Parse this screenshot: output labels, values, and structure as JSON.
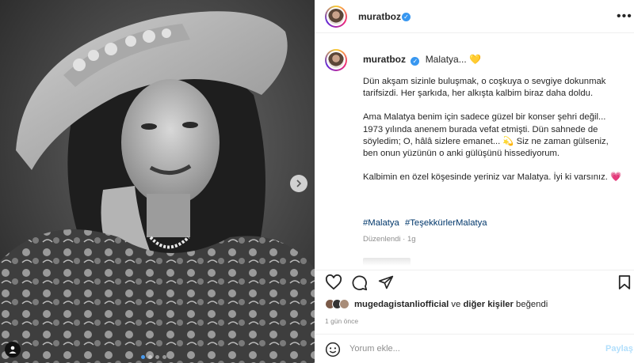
{
  "post": {
    "username": "muratboz",
    "caption_username": "muratboz",
    "location": "Malatya...",
    "location_emoji": "💛",
    "caption_paragraphs": [
      "Dün akşam sizinle buluşmak, o coşkuya o sevgiye dokunmak tarifsizdi. Her şarkıda, her alkışta kalbim biraz daha doldu.",
      "Ama Malatya benim için sadece güzel bir konser şehri değil... 1973 yılında anenem burada vefat etmişti. Dün sahnede de söyledim; O, hâlâ sizlere emanet... 💫 Siz ne zaman gülseniz, ben onun yüzünün o anki gülüşünü hissediyorum.",
      "Kalbimin en özel köşesinde yeriniz var Malatya. İyi ki varsınız. 💗"
    ],
    "hashtags": [
      "#Malatya",
      "#TeşekkürlerMalatya"
    ],
    "edited_label": "Düzenlendi · 1g",
    "liked_by_user": "mugedagistanliofficial",
    "liked_by_connector": "ve",
    "liked_by_others": "diğer kişiler",
    "liked_by_suffix": "beğendi",
    "time_ago": "1 gün önce",
    "comment_placeholder": "Yorum ekle...",
    "share_label": "Paylaş",
    "more_label": "•••"
  },
  "icons": {
    "verified": "verified-badge-icon",
    "heart": "heart-icon",
    "comment": "comment-icon",
    "share": "send-icon",
    "save": "bookmark-icon",
    "emoji": "smiley-icon",
    "next": "chevron-right-icon",
    "tag": "user-tag-icon"
  },
  "colors": {
    "verified": "#3897f0",
    "hashtag": "#00376b",
    "muted": "#8e8e8e",
    "share_disabled": "#b2dffc",
    "active_dot": "#4a9cf0"
  },
  "carousel": {
    "total": 4,
    "active_index": 0
  }
}
